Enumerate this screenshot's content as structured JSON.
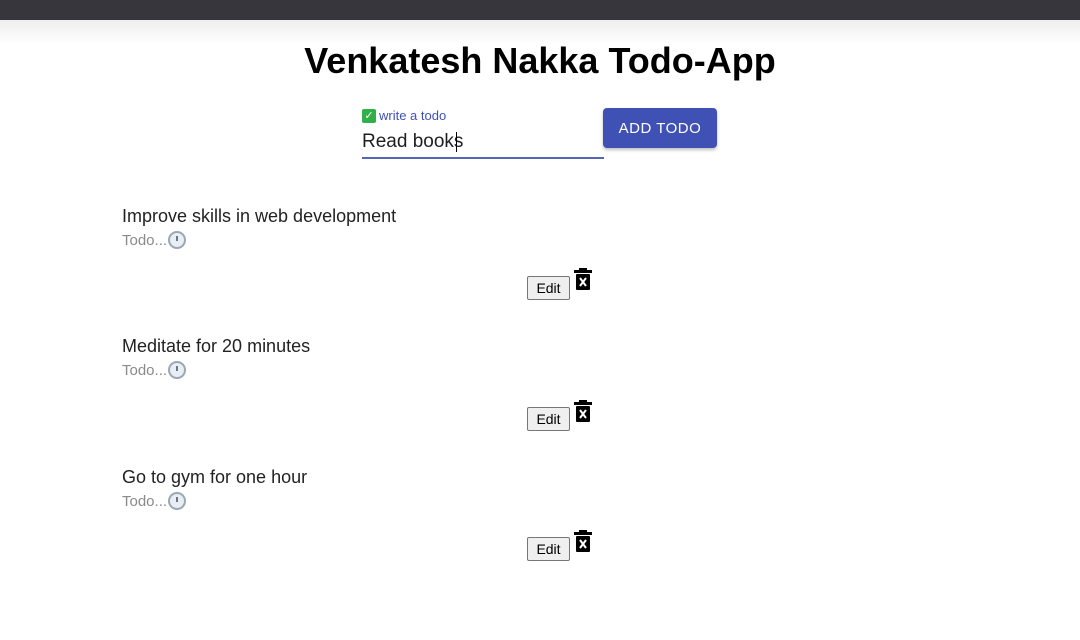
{
  "app": {
    "title": "Venkatesh Nakka Todo-App"
  },
  "form": {
    "label": "write a todo",
    "value": "Read books",
    "add_button": "ADD TODO"
  },
  "todos": [
    {
      "title": "Improve skills in web development",
      "status": "Todo...",
      "edit_label": "Edit"
    },
    {
      "title": "Meditate for 20 minutes",
      "status": "Todo...",
      "edit_label": "Edit"
    },
    {
      "title": "Go to gym for one hour",
      "status": "Todo...",
      "edit_label": "Edit"
    }
  ],
  "icons": {
    "label_icon": "check-mark-icon",
    "status_icon": "alarm-clock-icon",
    "delete_icon": "trash-icon"
  },
  "colors": {
    "primary": "#3f51b5",
    "topbar": "#36363c"
  }
}
